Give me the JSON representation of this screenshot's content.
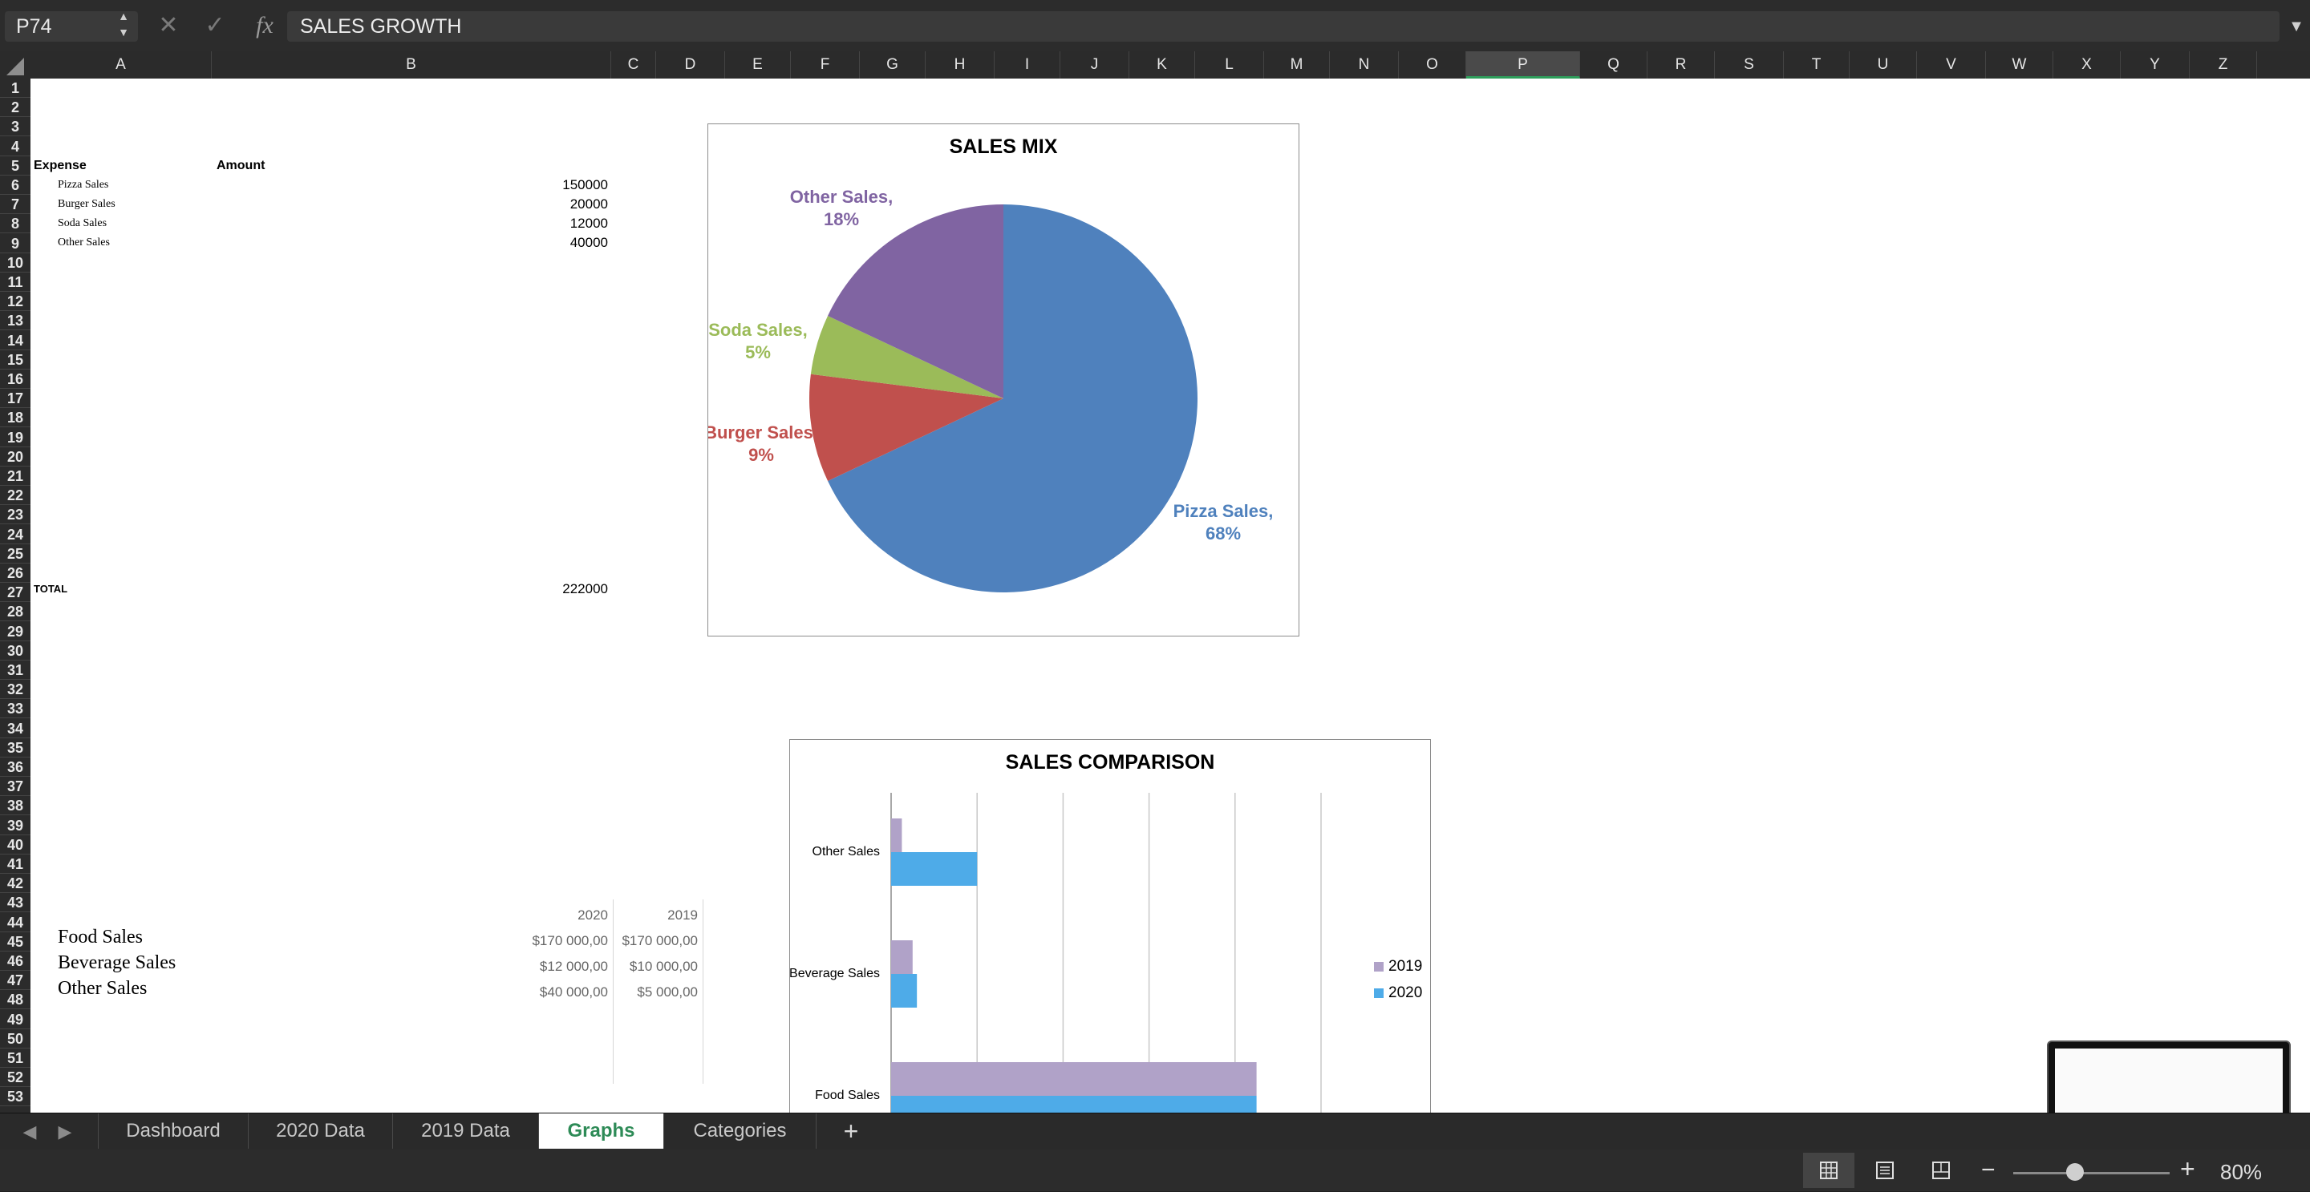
{
  "formula_bar": {
    "name_box": "P74",
    "cancel_icon": "close-icon",
    "enter_icon": "check-icon",
    "function_label": "fx",
    "formula": "SALES GROWTH"
  },
  "columns": [
    "A",
    "B",
    "C",
    "D",
    "E",
    "F",
    "G",
    "H",
    "I",
    "J",
    "K",
    "L",
    "M",
    "N",
    "O",
    "P",
    "Q",
    "R",
    "S",
    "T",
    "U",
    "V",
    "W",
    "X",
    "Y",
    "Z"
  ],
  "active_column": "P",
  "rows": [
    "1",
    "2",
    "3",
    "4",
    "5",
    "6",
    "7",
    "8",
    "9",
    "10",
    "11",
    "12",
    "13",
    "14",
    "15",
    "16",
    "17",
    "18",
    "19",
    "20",
    "21",
    "22",
    "23",
    "24",
    "25",
    "26",
    "27",
    "28",
    "29",
    "30",
    "31",
    "32",
    "33",
    "34",
    "35",
    "36",
    "37",
    "38",
    "39",
    "40",
    "41",
    "42",
    "43",
    "44",
    "45",
    "46",
    "47",
    "48",
    "49",
    "50",
    "51",
    "52",
    "53"
  ],
  "expense_table": {
    "header_expense": "Expense",
    "header_amount": "Amount",
    "rows": [
      {
        "label": "Pizza Sales",
        "amount": "150000"
      },
      {
        "label": "Burger Sales",
        "amount": "20000"
      },
      {
        "label": "Soda Sales",
        "amount": "12000"
      },
      {
        "label": "Other Sales",
        "amount": "40000"
      }
    ],
    "total_label": "TOTAL",
    "total_value": "222000"
  },
  "comparison_table": {
    "year_2020": "2020",
    "year_2019": "2019",
    "rows": [
      {
        "label": "Food Sales",
        "v2020": "$170 000,00",
        "v2019": "$170 000,00"
      },
      {
        "label": "Beverage Sales",
        "v2020": "$12 000,00",
        "v2019": "$10 000,00"
      },
      {
        "label": "Other Sales",
        "v2020": "$40 000,00",
        "v2019": "$5 000,00"
      }
    ]
  },
  "chart_data": [
    {
      "type": "pie",
      "title": "SALES MIX",
      "slices": [
        {
          "label": "Pizza Sales",
          "percent": 68,
          "display": "Pizza Sales,\n68%",
          "color": "#4f81bd"
        },
        {
          "label": "Burger Sales",
          "percent": 9,
          "display": "Burger Sales,\n9%",
          "color": "#c0504d"
        },
        {
          "label": "Soda Sales",
          "percent": 5,
          "display": "Soda Sales,\n5%",
          "color": "#9bbb59"
        },
        {
          "label": "Other Sales",
          "percent": 18,
          "display": "Other Sales,\n18%",
          "color": "#8064a2"
        }
      ]
    },
    {
      "type": "bar",
      "orientation": "horizontal",
      "title": "SALES COMPARISON",
      "categories": [
        "Other Sales",
        "Beverage Sales",
        "Food Sales"
      ],
      "series": [
        {
          "name": "2019",
          "values": [
            5000,
            10000,
            170000
          ],
          "color": "#b0a2c8"
        },
        {
          "name": "2020",
          "values": [
            40000,
            12000,
            170000
          ],
          "color": "#4eabe8"
        }
      ],
      "xlim": [
        0,
        200000
      ],
      "grid": true,
      "legend": "right"
    }
  ],
  "tabs": [
    {
      "label": "Dashboard",
      "active": false
    },
    {
      "label": "2020 Data",
      "active": false
    },
    {
      "label": "2019 Data",
      "active": false
    },
    {
      "label": "Graphs",
      "active": true
    },
    {
      "label": "Categories",
      "active": false
    }
  ],
  "status_bar": {
    "zoom_level": "80%"
  }
}
